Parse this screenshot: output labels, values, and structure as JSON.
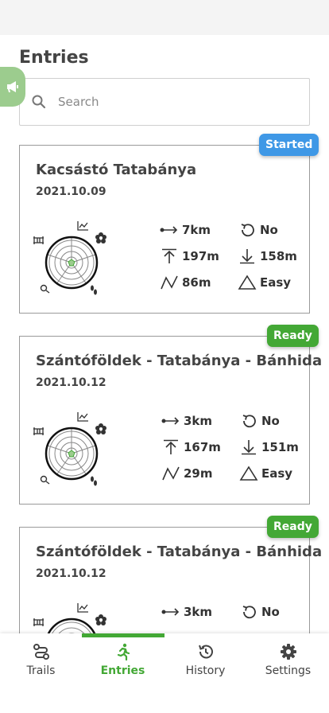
{
  "page": {
    "title": "Entries"
  },
  "search": {
    "placeholder": "Search"
  },
  "entries": [
    {
      "title": "Kacsástó Tatabánya",
      "date": "2021.10.09",
      "status": "Started",
      "status_color": "#3f98e6",
      "distance": "7km",
      "ascent": "197m",
      "descent": "158m",
      "elevation": "86m",
      "loop": "No",
      "difficulty": "Easy"
    },
    {
      "title": "Szántóföldek - Tatabánya - Bánhida",
      "date": "2021.10.12",
      "status": "Ready",
      "status_color": "#43a835",
      "distance": "3km",
      "ascent": "167m",
      "descent": "151m",
      "elevation": "29m",
      "loop": "No",
      "difficulty": "Easy"
    },
    {
      "title": "Szántóföldek - Tatabánya - Bánhida",
      "date": "2021.10.12",
      "status": "Ready",
      "status_color": "#43a835",
      "distance": "3km",
      "loop": "No"
    }
  ],
  "nav": {
    "items": [
      {
        "label": "Trails",
        "icon": "trails-icon"
      },
      {
        "label": "Entries",
        "icon": "running-icon",
        "active": true
      },
      {
        "label": "History",
        "icon": "history-icon"
      },
      {
        "label": "Settings",
        "icon": "gear-icon"
      }
    ],
    "active_color": "#43a835"
  }
}
